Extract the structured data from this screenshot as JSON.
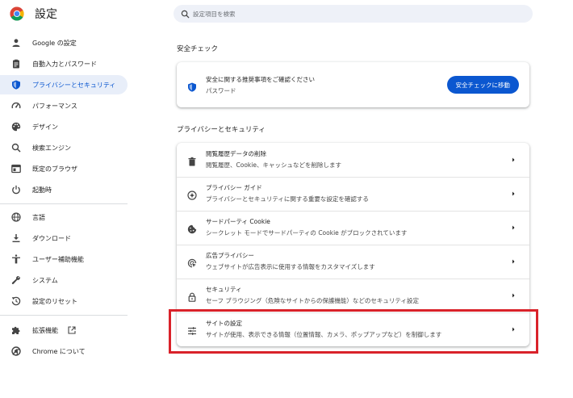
{
  "app": {
    "title": "設定"
  },
  "search": {
    "placeholder": "設定項目を検索"
  },
  "sidebar": {
    "items": [
      {
        "label": "Google の設定",
        "icon": "person-icon"
      },
      {
        "label": "自動入力とパスワード",
        "icon": "clipboard-icon"
      },
      {
        "label": "プライバシーとセキュリティ",
        "icon": "shield-icon",
        "active": true
      },
      {
        "label": "パフォーマンス",
        "icon": "speedometer-icon"
      },
      {
        "label": "デザイン",
        "icon": "palette-icon"
      },
      {
        "label": "検索エンジン",
        "icon": "search-icon"
      },
      {
        "label": "既定のブラウザ",
        "icon": "browser-icon"
      },
      {
        "label": "起動時",
        "icon": "power-icon"
      },
      {
        "label": "言語",
        "icon": "globe-icon"
      },
      {
        "label": "ダウンロード",
        "icon": "download-icon"
      },
      {
        "label": "ユーザー補助機能",
        "icon": "accessibility-icon"
      },
      {
        "label": "システム",
        "icon": "wrench-icon"
      },
      {
        "label": "設定のリセット",
        "icon": "reset-icon"
      },
      {
        "label": "拡張機能",
        "icon": "extension-icon"
      },
      {
        "label": "Chrome について",
        "icon": "chrome-icon"
      }
    ]
  },
  "safety_check": {
    "heading": "安全チェック",
    "title": "安全に関する推奨事項をご確認ください",
    "subtitle": "パスワード",
    "button": "安全チェックに移動"
  },
  "privacy": {
    "heading": "プライバシーとセキュリティ",
    "rows": [
      {
        "title": "閲覧履歴データの削除",
        "subtitle": "閲覧履歴、Cookie、キャッシュなどを削除します",
        "icon": "trash-icon"
      },
      {
        "title": "プライバシー ガイド",
        "subtitle": "プライバシーとセキュリティに関する重要な設定を確認する",
        "icon": "compass-icon"
      },
      {
        "title": "サードパーティ Cookie",
        "subtitle": "シークレット モードでサードパーティの Cookie がブロックされています",
        "icon": "cookie-icon"
      },
      {
        "title": "広告プライバシー",
        "subtitle": "ウェブサイトが広告表示に使用する情報をカスタマイズします",
        "icon": "ad-privacy-icon"
      },
      {
        "title": "セキュリティ",
        "subtitle": "セーフ ブラウジング（危険なサイトからの保護機能）などのセキュリティ設定",
        "icon": "lock-icon"
      },
      {
        "title": "サイトの設定",
        "subtitle": "サイトが使用、表示できる情報（位置情報、カメラ、ポップアップなど）を制御します",
        "icon": "tune-icon"
      }
    ]
  },
  "colors": {
    "accent": "#0b57d0",
    "highlight": "#d9222a",
    "active_bg": "#e8eef9"
  }
}
